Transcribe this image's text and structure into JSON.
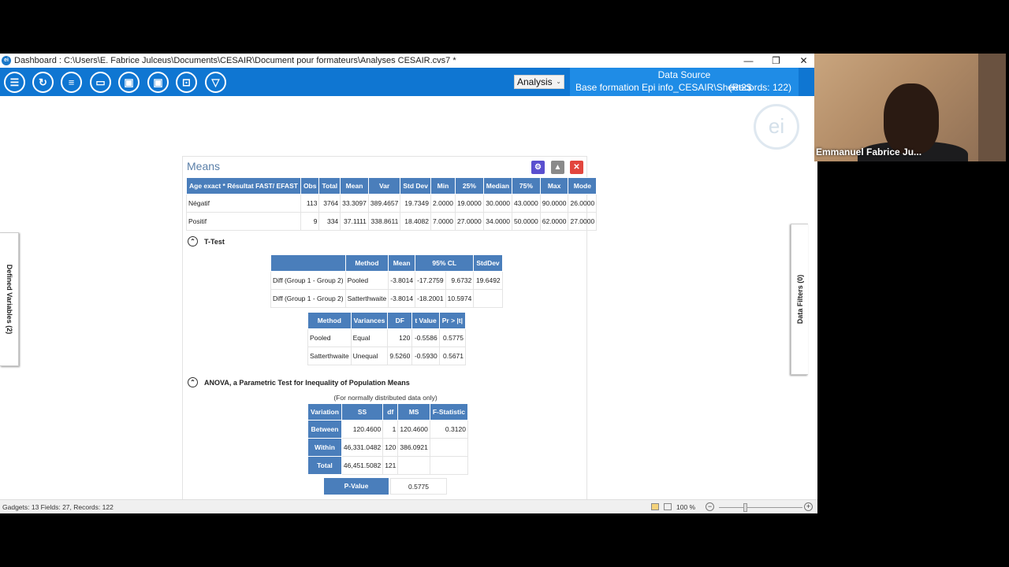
{
  "window": {
    "title": "Dashboard : C:\\Users\\E. Fabrice Julceus\\Documents\\CESAIR\\Document pour formateurs\\Analyses CESAIR.cvs7 *",
    "controls": {
      "minimize": "—",
      "restore": "❐",
      "close": "✕"
    }
  },
  "toolbar": {
    "buttons": [
      {
        "icon": "list-icon",
        "glyph": "☰"
      },
      {
        "icon": "refresh-icon",
        "glyph": "↻"
      },
      {
        "icon": "database-icon",
        "glyph": "≡"
      },
      {
        "icon": "folder-open-icon",
        "glyph": "▭"
      },
      {
        "icon": "save-icon",
        "glyph": "▣"
      },
      {
        "icon": "save-as-icon",
        "glyph": "▣"
      },
      {
        "icon": "export-icon",
        "glyph": "⊡"
      },
      {
        "icon": "filter-icon",
        "glyph": "▽"
      }
    ],
    "analysis_label": "Analysis",
    "datasource": {
      "title": "Data Source",
      "name": "Base formation Epi info_CESAIR\\Sheet2$",
      "records": "(Records: 122)"
    }
  },
  "side_panels": {
    "left": "Defined Variables (2)",
    "right": "Data Filters (0)"
  },
  "gadget": {
    "title": "Means",
    "means_table": {
      "headers": [
        "Age exact * Résultat FAST/ EFAST",
        "Obs",
        "Total",
        "Mean",
        "Var",
        "Std Dev",
        "Min",
        "25%",
        "Median",
        "75%",
        "Max",
        "Mode"
      ],
      "rows": [
        [
          "Négatif",
          "113",
          "3764",
          "33.3097",
          "389.4657",
          "19.7349",
          "2.0000",
          "19.0000",
          "30.0000",
          "43.0000",
          "90.0000",
          "26.0000"
        ],
        [
          "Positif",
          "9",
          "334",
          "37.1111",
          "338.8611",
          "18.4082",
          "7.0000",
          "27.0000",
          "34.0000",
          "50.0000",
          "62.0000",
          "27.0000"
        ]
      ]
    },
    "ttest": {
      "section_label": "T-Test",
      "table1": {
        "headers": [
          "",
          "Method",
          "Mean",
          "95%   CL",
          "StdDev"
        ],
        "rows": [
          [
            "Diff (Group 1 - Group 2)",
            "Pooled",
            "-3.8014",
            "-17.2759",
            "9.6732",
            "19.6492"
          ],
          [
            "Diff (Group 1 - Group 2)",
            "Satterthwaite",
            "-3.8014",
            "-18.2001",
            "10.5974",
            ""
          ]
        ]
      },
      "table2": {
        "headers": [
          "Method",
          "Variances",
          "DF",
          "t Value",
          "Pr > |t|"
        ],
        "rows": [
          [
            "Pooled",
            "Equal",
            "120",
            "-0.5586",
            "0.5775"
          ],
          [
            "Satterthwaite",
            "Unequal",
            "9.5260",
            "-0.5930",
            "0.5671"
          ]
        ]
      }
    },
    "anova": {
      "section_label": "ANOVA, a Parametric Test for Inequality of Population Means",
      "note": "(For normally distributed data only)",
      "headers": [
        "Variation",
        "SS",
        "df",
        "MS",
        "F-Statistic"
      ],
      "rows": [
        [
          "Between",
          "120.4600",
          "1",
          "120.4600",
          "0.3120"
        ],
        [
          "Within",
          "46,331.0482",
          "120",
          "386.0921",
          ""
        ],
        [
          "Total",
          "46,451.5082",
          "121",
          "",
          ""
        ]
      ],
      "pvalue_label": "P-Value",
      "pvalue": "0.5775"
    }
  },
  "statusbar": {
    "left": "Gadgets: 13  Fields: 27, Records: 122",
    "zoom": "100 %"
  },
  "webcam": {
    "participant_name": "Emmanuel Fabrice Ju..."
  }
}
